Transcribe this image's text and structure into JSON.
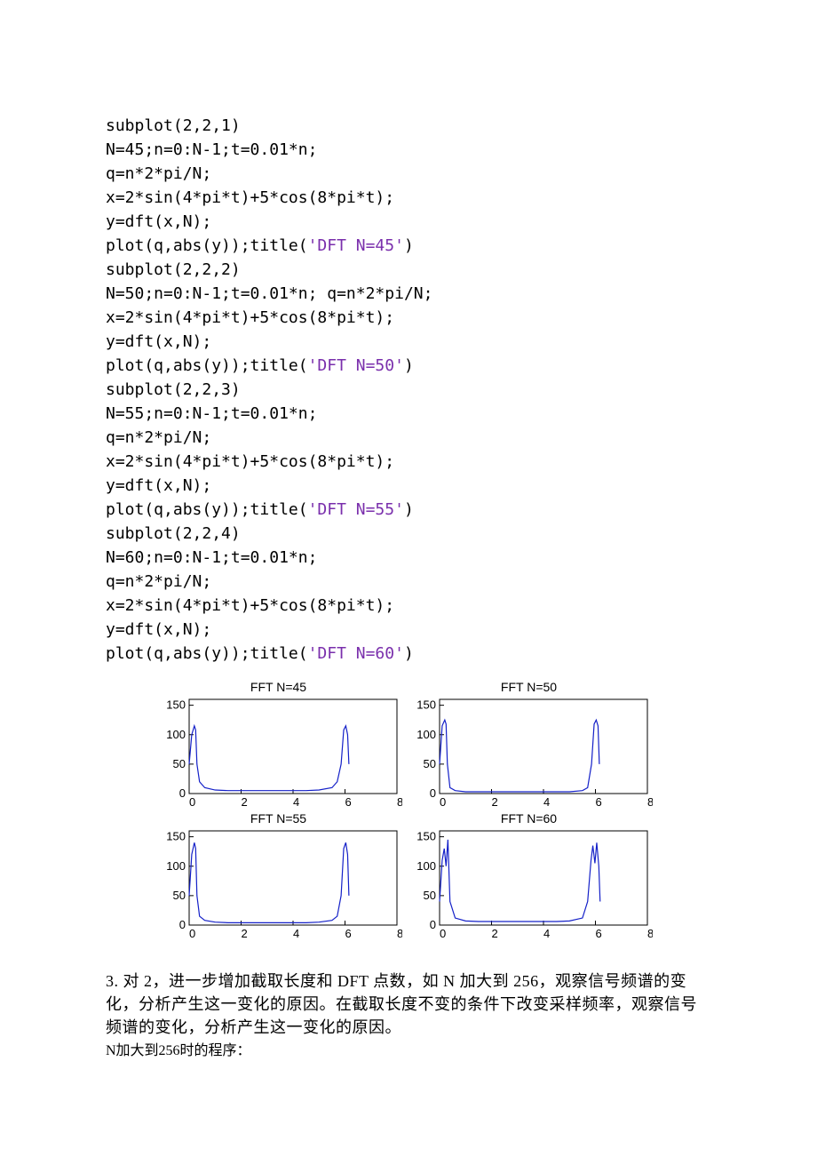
{
  "code": {
    "l1": "subplot(2,2,1)",
    "l2": "N=45;n=0:N-1;t=0.01*n;",
    "l3": "q=n*2*pi/N;",
    "l4": "x=2*sin(4*pi*t)+5*cos(8*pi*t);",
    "l5": "y=dft(x,N);",
    "l6a": "plot(q,abs(y));title(",
    "l6s": "'DFT N=45'",
    "l6b": ")",
    "l7": "subplot(2,2,2)",
    "l8": "N=50;n=0:N-1;t=0.01*n; q=n*2*pi/N;",
    "l9": "x=2*sin(4*pi*t)+5*cos(8*pi*t);",
    "l10": "y=dft(x,N);",
    "l11a": "plot(q,abs(y));title(",
    "l11s": "'DFT N=50'",
    "l11b": ")",
    "l12": "subplot(2,2,3)",
    "l13": "N=55;n=0:N-1;t=0.01*n;",
    "l14": "q=n*2*pi/N;",
    "l15": "x=2*sin(4*pi*t)+5*cos(8*pi*t);",
    "l16": "y=dft(x,N);",
    "l17a": "plot(q,abs(y));title(",
    "l17s": "'DFT N=55'",
    "l17b": ")",
    "l18": "subplot(2,2,4)",
    "l19": "N=60;n=0:N-1;t=0.01*n;",
    "l20": "q=n*2*pi/N;",
    "l21": "x=2*sin(4*pi*t)+5*cos(8*pi*t);",
    "l22": "y=dft(x,N);",
    "l23a": "plot(q,abs(y));title(",
    "l23s": "'DFT N=60'",
    "l23b": ")"
  },
  "chart_data": [
    {
      "type": "line",
      "title": "FFT N=45",
      "xlim": [
        0,
        8
      ],
      "ylim": [
        0,
        160
      ],
      "xticks": [
        0,
        2,
        4,
        6,
        8
      ],
      "yticks": [
        0,
        50,
        100,
        150
      ],
      "x": [
        0,
        0.1,
        0.2,
        0.25,
        0.3,
        0.4,
        0.6,
        1.0,
        1.5,
        2.0,
        2.5,
        3.0,
        3.5,
        4.0,
        4.5,
        5.0,
        5.5,
        5.7,
        5.85,
        5.95,
        6.03,
        6.1,
        6.15
      ],
      "y": [
        50,
        100,
        115,
        108,
        50,
        20,
        10,
        6,
        5,
        5,
        5,
        5,
        5,
        5,
        5,
        6,
        10,
        20,
        50,
        108,
        115,
        100,
        50
      ]
    },
    {
      "type": "line",
      "title": "FFT N=50",
      "xlim": [
        0,
        8
      ],
      "ylim": [
        0,
        160
      ],
      "xticks": [
        0,
        2,
        4,
        6,
        8
      ],
      "yticks": [
        0,
        50,
        100,
        150
      ],
      "x": [
        0,
        0.1,
        0.2,
        0.25,
        0.3,
        0.4,
        0.6,
        1.0,
        1.5,
        2.0,
        2.5,
        3.0,
        3.5,
        4.0,
        4.5,
        5.0,
        5.5,
        5.7,
        5.85,
        5.95,
        6.03,
        6.1,
        6.15
      ],
      "y": [
        50,
        115,
        125,
        118,
        50,
        10,
        5,
        3,
        3,
        3,
        3,
        3,
        3,
        3,
        3,
        3,
        5,
        10,
        50,
        118,
        125,
        115,
        50
      ]
    },
    {
      "type": "line",
      "title": "FFT N=55",
      "xlim": [
        0,
        8
      ],
      "ylim": [
        0,
        160
      ],
      "xticks": [
        0,
        2,
        4,
        6,
        8
      ],
      "yticks": [
        0,
        50,
        100,
        150
      ],
      "x": [
        0,
        0.1,
        0.2,
        0.25,
        0.3,
        0.4,
        0.6,
        1.0,
        1.5,
        2.0,
        2.5,
        3.0,
        3.5,
        4.0,
        4.5,
        5.0,
        5.5,
        5.7,
        5.85,
        5.95,
        6.03,
        6.1,
        6.15
      ],
      "y": [
        50,
        120,
        140,
        130,
        50,
        15,
        8,
        5,
        4,
        4,
        4,
        4,
        4,
        4,
        4,
        5,
        8,
        15,
        50,
        130,
        140,
        120,
        50
      ]
    },
    {
      "type": "line",
      "title": "FFT N=60",
      "xlim": [
        0,
        8
      ],
      "ylim": [
        0,
        160
      ],
      "xticks": [
        0,
        2,
        4,
        6,
        8
      ],
      "yticks": [
        0,
        50,
        100,
        150
      ],
      "x": [
        0,
        0.1,
        0.18,
        0.25,
        0.32,
        0.4,
        0.6,
        1.0,
        1.5,
        2.0,
        2.5,
        3.0,
        3.5,
        4.0,
        4.5,
        5.0,
        5.5,
        5.7,
        5.83,
        5.9,
        5.98,
        6.05,
        6.13,
        6.18
      ],
      "y": [
        40,
        110,
        130,
        100,
        145,
        40,
        12,
        7,
        6,
        6,
        6,
        6,
        6,
        6,
        6,
        7,
        12,
        40,
        110,
        135,
        105,
        140,
        100,
        40
      ]
    }
  ],
  "paragraph": {
    "q3": "3. 对 2，进一步增加截取长度和 DFT 点数，如 N 加大到 256，观察信号频谱的变化，分析产生这一变化的原因。在截取长度不变的条件下改变采样频率，观察信号频谱的变化，分析产生这一变化的原因。",
    "sub": "N加大到256时的程序："
  }
}
